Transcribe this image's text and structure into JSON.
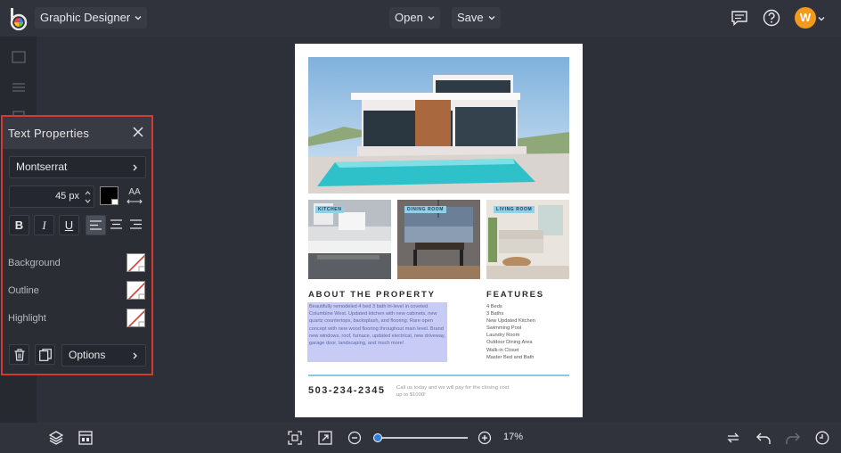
{
  "topbar": {
    "design_type": "Graphic Designer",
    "open_label": "Open",
    "save_label": "Save",
    "avatar_initial": "W",
    "avatar_color": "#f29a1e"
  },
  "panel": {
    "title": "Text Properties",
    "font_family": "Montserrat",
    "font_size": "45",
    "font_size_unit": "px",
    "text_color": "#000000",
    "case_toggle_label": "AA",
    "bold_label": "B",
    "italic_label": "I",
    "underline_label": "U",
    "background_label": "Background",
    "outline_label": "Outline",
    "highlight_label": "Highlight",
    "options_label": "Options",
    "accent_border": "#d6392f"
  },
  "document": {
    "tags": [
      "KITCHEN",
      "DINING ROOM",
      "LIVING ROOM"
    ],
    "about_heading": "ABOUT THE PROPERTY",
    "about_text": "Beautifully remodeled 4 bed 3 bath tri-level in coveted Columbine West. Updated kitchen with new cabinets, new quartz countertops, backsplash, and flooring. Rare open concept with new wood flooring throughout main level. Brand new windows, roof, furnace, updated electrical, new driveway, garage door, landscaping, and much more!",
    "features_heading": "FEATURES",
    "features": [
      "4 Beds",
      "3 Baths",
      "New Updated Kitchen",
      "Swimming Pool",
      "Laundry Room",
      "Outdoor Dining Area",
      "Walk-in Closet",
      "Master Bed and Bath"
    ],
    "phone": "503-234-2345",
    "cta": "Call us today and we will pay for the closing cost up to $1000!"
  },
  "zoom": {
    "level_label": "17%",
    "slider_fraction": 0.17
  }
}
